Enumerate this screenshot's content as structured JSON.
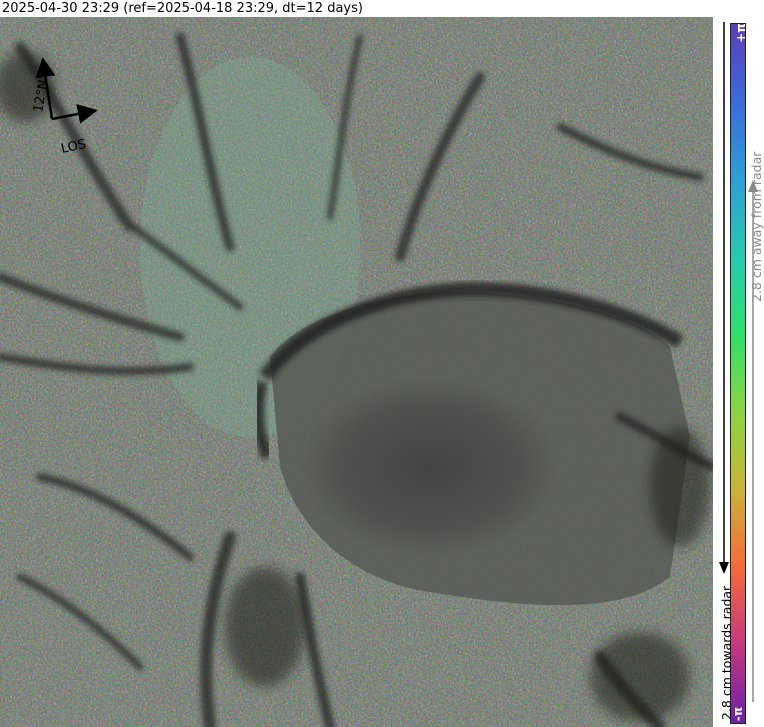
{
  "title": "2025-04-30 23:29 (ref=2025-04-18 23:29, dt=12 days)",
  "compass": {
    "north_label": "12°N",
    "los_label": "LOS"
  },
  "colorbar": {
    "top_label": "+π",
    "bottom_label": "-π",
    "away_label": "2.8 cm away from radar",
    "towards_label": "2.8 cm towards radar",
    "colors": [
      "#6a1fa8",
      "#c2397e",
      "#f46a3c",
      "#c8b43a",
      "#8bd443",
      "#2fe06a",
      "#27c9b0",
      "#2f9ed6",
      "#3b6ad9",
      "#5b3fb8"
    ]
  }
}
